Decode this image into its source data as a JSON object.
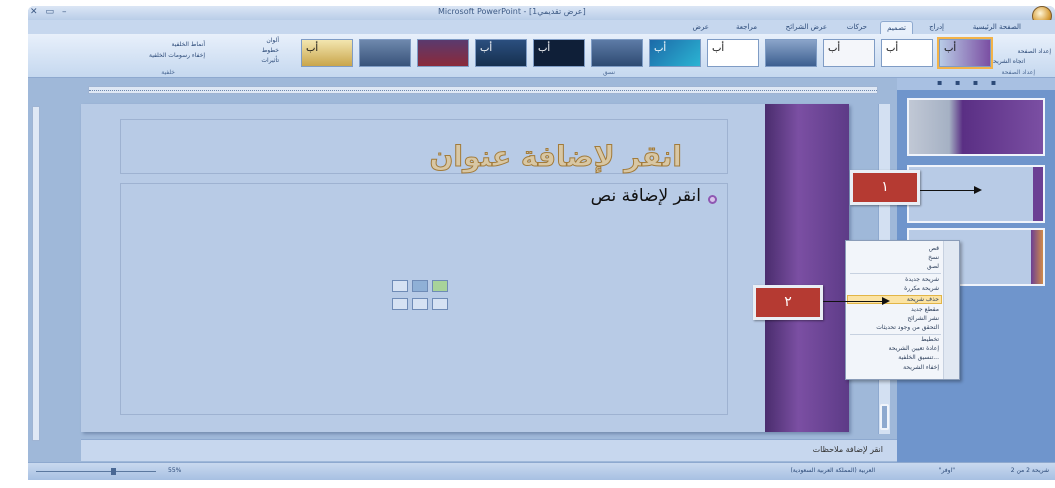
{
  "window": {
    "title": "Microsoft PowerPoint - [عرض تقديمي1]"
  },
  "tabs": [
    {
      "label": "الصفحة الرئيسية"
    },
    {
      "label": "إدراج"
    },
    {
      "label": "تصميم",
      "active": true
    },
    {
      "label": "حركات"
    },
    {
      "label": "عرض الشرائح"
    },
    {
      "label": "مراجعة"
    },
    {
      "label": "عرض"
    }
  ],
  "ribbon": {
    "page_setup_group": "إعداد الصفحة",
    "page_setup_btn": "إعداد الصفحة",
    "orientation_btn": "اتجاه الشريحة",
    "themes_group": "نسق",
    "colors_btn": "ألوان",
    "fonts_btn": "خطوط",
    "effects_btn": "تأثيرات",
    "background_styles_btn": "أنماط الخلفية",
    "hide_bg_btn": "إخفاء رسومات الخلفية",
    "background_group": "خلفية",
    "theme_glyph": "أب"
  },
  "slide": {
    "title_placeholder": "انقر لإضافة عنوان",
    "body_placeholder": "انقر لإضافة نص"
  },
  "notes": {
    "placeholder": "انقر لإضافة ملاحظات"
  },
  "pane": {
    "tabs": "▪ ▪ ▪ ▪"
  },
  "context_menu": {
    "items": [
      {
        "label": "قص"
      },
      {
        "label": "نسخ"
      },
      {
        "label": "لصق"
      },
      {
        "label": "شريحة جديدة"
      },
      {
        "label": "شريحة مكررة"
      },
      {
        "label": "حذف شريحة",
        "highlighted": true
      },
      {
        "label": "مقطع جديد"
      },
      {
        "label": "نشر الشرائح"
      },
      {
        "label": "التحقق من وجود تحديثات"
      },
      {
        "label": "تخطيط"
      },
      {
        "label": "إعادة تعيين الشريحة"
      },
      {
        "label": "تنسيق الخلفية..."
      },
      {
        "label": "إخفاء الشريحة"
      }
    ]
  },
  "callouts": {
    "first": "١",
    "second": "٢"
  },
  "status": {
    "slide_info": "شريحة 2 من 2",
    "theme_name": "\"اوفر\"",
    "language": "العربية (المملكة العربية السعودية)",
    "zoom": "55%"
  }
}
